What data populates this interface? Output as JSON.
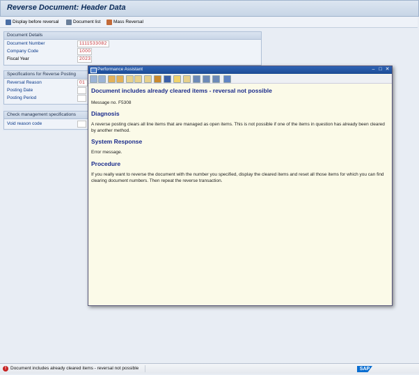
{
  "screen": {
    "title": "Reverse Document: Header Data"
  },
  "toolbar": {
    "display_before_reversal": "Display before reversal",
    "document_list": "Document list",
    "mass_reversal": "Mass Reversal"
  },
  "document_details": {
    "header": "Document Details",
    "document_number_label": "Document Number",
    "document_number_value": "1111533082",
    "company_code_label": "Company Code",
    "company_code_value": "1000",
    "fiscal_year_label": "Fiscal Year",
    "fiscal_year_value": "2023"
  },
  "reverse_specs": {
    "header": "Specifications for Reverse Posting",
    "reversal_reason_label": "Reversal Reason",
    "reversal_reason_value": "01",
    "posting_date_label": "Posting Date",
    "posting_period_label": "Posting Period"
  },
  "check_mgmt": {
    "header": "Check management specifications",
    "void_reason_label": "Void reason code"
  },
  "popup": {
    "title": "Performance Assistant",
    "heading": "Document includes already cleared items - reversal not possible",
    "message_no": "Message no. F5308",
    "diagnosis_title": "Diagnosis",
    "diagnosis_text": "A reverse posting clears all line items that are managed as open items. This is not possible if one of the items in question has already been cleared by another method.",
    "system_response_title": "System Response",
    "system_response_text": "Error message.",
    "procedure_title": "Procedure",
    "procedure_text": "If you really want to reverse the document with the number you specified, display the cleared items and reset all those items for which you can find clearing document numbers. Then repeat the reverse transaction."
  },
  "statusbar": {
    "message": "Document includes already cleared items - reversal not possible",
    "logo": "SAP"
  }
}
